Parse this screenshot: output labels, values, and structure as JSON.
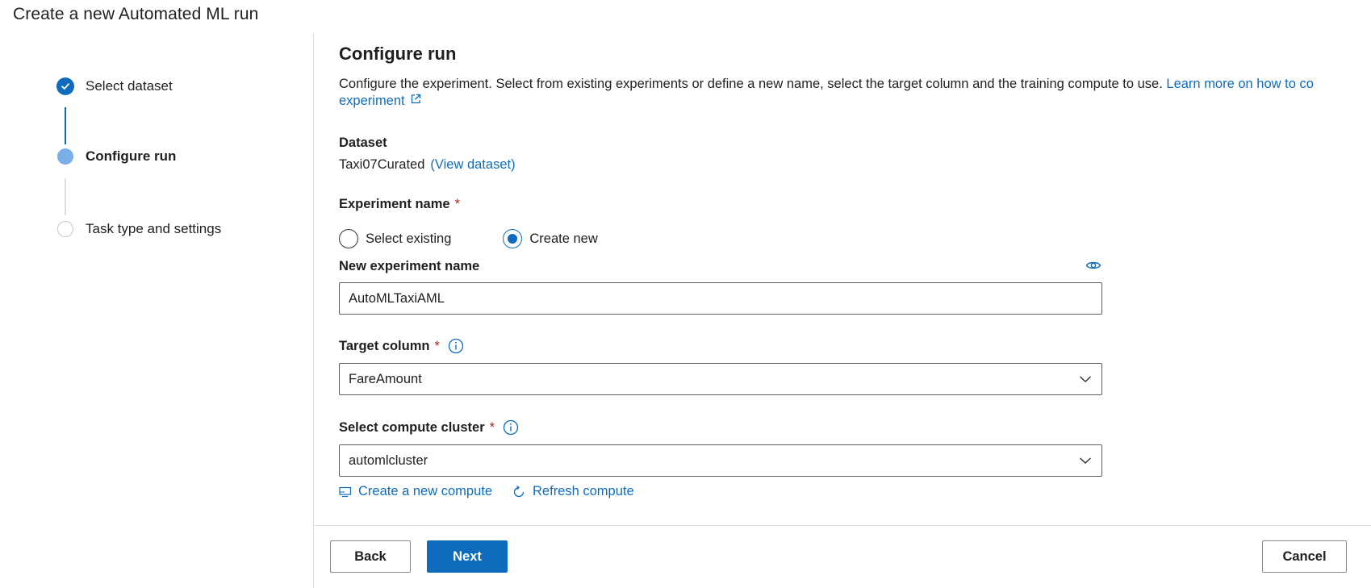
{
  "page": {
    "title": "Create a new Automated ML run"
  },
  "stepper": {
    "steps": [
      {
        "label": "Select dataset",
        "state": "done"
      },
      {
        "label": "Configure run",
        "state": "active"
      },
      {
        "label": "Task type and settings",
        "state": "todo"
      }
    ]
  },
  "form": {
    "heading": "Configure run",
    "description": "Configure the experiment. Select from existing experiments or define a new name, select the target column and the training compute to use.",
    "learn_more_link": "Learn more on how to co",
    "learn_more_link_cont": "experiment",
    "dataset": {
      "label": "Dataset",
      "value": "Taxi07Curated",
      "view_link": "(View dataset)"
    },
    "experiment": {
      "label": "Experiment name",
      "required_mark": "*",
      "options": [
        "Select existing",
        "Create new"
      ],
      "selected": "Create new",
      "new_name_label": "New experiment name",
      "new_name_value": "AutoMLTaxiAML"
    },
    "target_column": {
      "label": "Target column",
      "required_mark": "*",
      "value": "FareAmount"
    },
    "compute_cluster": {
      "label": "Select compute cluster",
      "required_mark": "*",
      "value": "automlcluster",
      "create_link": "Create a new compute",
      "refresh_link": "Refresh compute"
    }
  },
  "footer": {
    "back_label": "Back",
    "next_label": "Next",
    "cancel_label": "Cancel"
  },
  "colors": {
    "accent": "#0f6cbd",
    "step_active": "#79aee8",
    "required": "#a4262c",
    "divider": "#e1dfdd"
  }
}
